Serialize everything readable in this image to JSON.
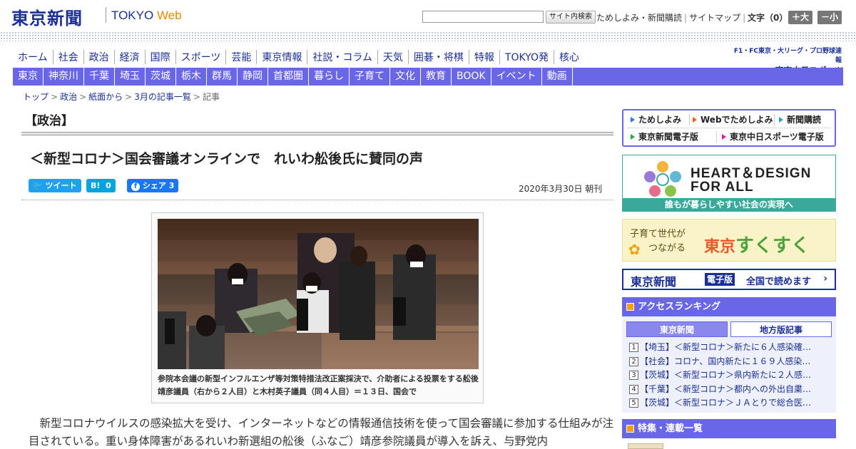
{
  "header": {
    "logo": "東京新聞",
    "logo_sub_main": "TOKYO ",
    "logo_sub_accent": "Web",
    "search_placeholder": "",
    "search_button": "サイト内検索",
    "links": [
      "ためしよみ・新聞購読",
      "サイトマップ"
    ],
    "font_size_label": "文字（0）",
    "font_plus": "＋大",
    "font_minus": "－小"
  },
  "nav_primary": [
    "ホーム",
    "社会",
    "政治",
    "経済",
    "国際",
    "スポーツ",
    "芸能",
    "東京情報",
    "社説・コラム",
    "天気",
    "囲碁・将棋",
    "特報",
    "TOKYO発",
    "核心"
  ],
  "chunichi_banner": {
    "line1": "F1・FC東京・大リーグ・プロ野球速報",
    "line2": "東京中日スポーツ"
  },
  "nav_secondary": [
    "東京",
    "神奈川",
    "千葉",
    "埼玉",
    "茨城",
    "栃木",
    "群馬",
    "静岡",
    "首都圏",
    "暮らし",
    "子育て",
    "文化",
    "教育",
    "BOOK",
    "イベント",
    "動画"
  ],
  "breadcrumb": [
    "トップ",
    "政治",
    "紙面から",
    "3月の記事一覧",
    "記事"
  ],
  "breadcrumb_sep": ">",
  "section_title": "【政治】",
  "article": {
    "title": "＜新型コロナ＞国会審議オンラインで　れいわ舩後氏に賛同の声",
    "share": {
      "tweet": "ツイート",
      "hatena_label": "B!",
      "hatena_count": "0",
      "facebook_label": "シェア",
      "facebook_count": "3"
    },
    "date": "2020年3月30日 朝刊",
    "caption": "参院本会議の新型インフルエンザ等対策特措法改正案採決で、介助者による投票をする舩後靖彦議員（右から２人目）と木村英子議員（同４人目）＝１３日、国会で",
    "body": "新型コロナウイルスの感染拡大を受け、インターネットなどの情報通信技術を使って国会審議に参加する仕組みが注目されている。重い身体障害があるれいわ新選組の舩後（ふなご）靖彦参院議員が導入を訴え、与野党内"
  },
  "sidebar": {
    "links": [
      "ためしよみ",
      "Webでためしよみ",
      "新聞購読",
      "東京新聞電子版",
      "東京中日スポーツ電子版"
    ],
    "heart_design": {
      "line1": "HEART＆DESIGN",
      "line2": "FOR ALL",
      "bar": "誰もが暮らしやすい社会の実現へ"
    },
    "sukusuku": {
      "line1": "子育て世代が",
      "line2": "つながる",
      "brand_a": "東京",
      "brand_b": "すくすく"
    },
    "epaper": {
      "a": "東京新聞",
      "b": "電子版",
      "c": "全国で読めます",
      "d": "›"
    },
    "ranking": {
      "title": "アクセスランキング",
      "tab_active": "東京新聞",
      "tab_inactive": "地方版記事",
      "items": [
        {
          "num": "1",
          "text": "【埼玉】＜新型コロナ＞新たに６人感染確…"
        },
        {
          "num": "2",
          "text": "【社会】コロナ、国内新たに１６９人感染…"
        },
        {
          "num": "3",
          "text": "【茨城】＜新型コロナ＞県内新たに２人感…"
        },
        {
          "num": "4",
          "text": "【千葉】＜新型コロナ＞都内への外出自粛…"
        },
        {
          "num": "5",
          "text": "【茨城】＜新型コロナ＞ＪＡとりで総合医…"
        }
      ]
    },
    "features_title": "特集・連載一覧"
  }
}
